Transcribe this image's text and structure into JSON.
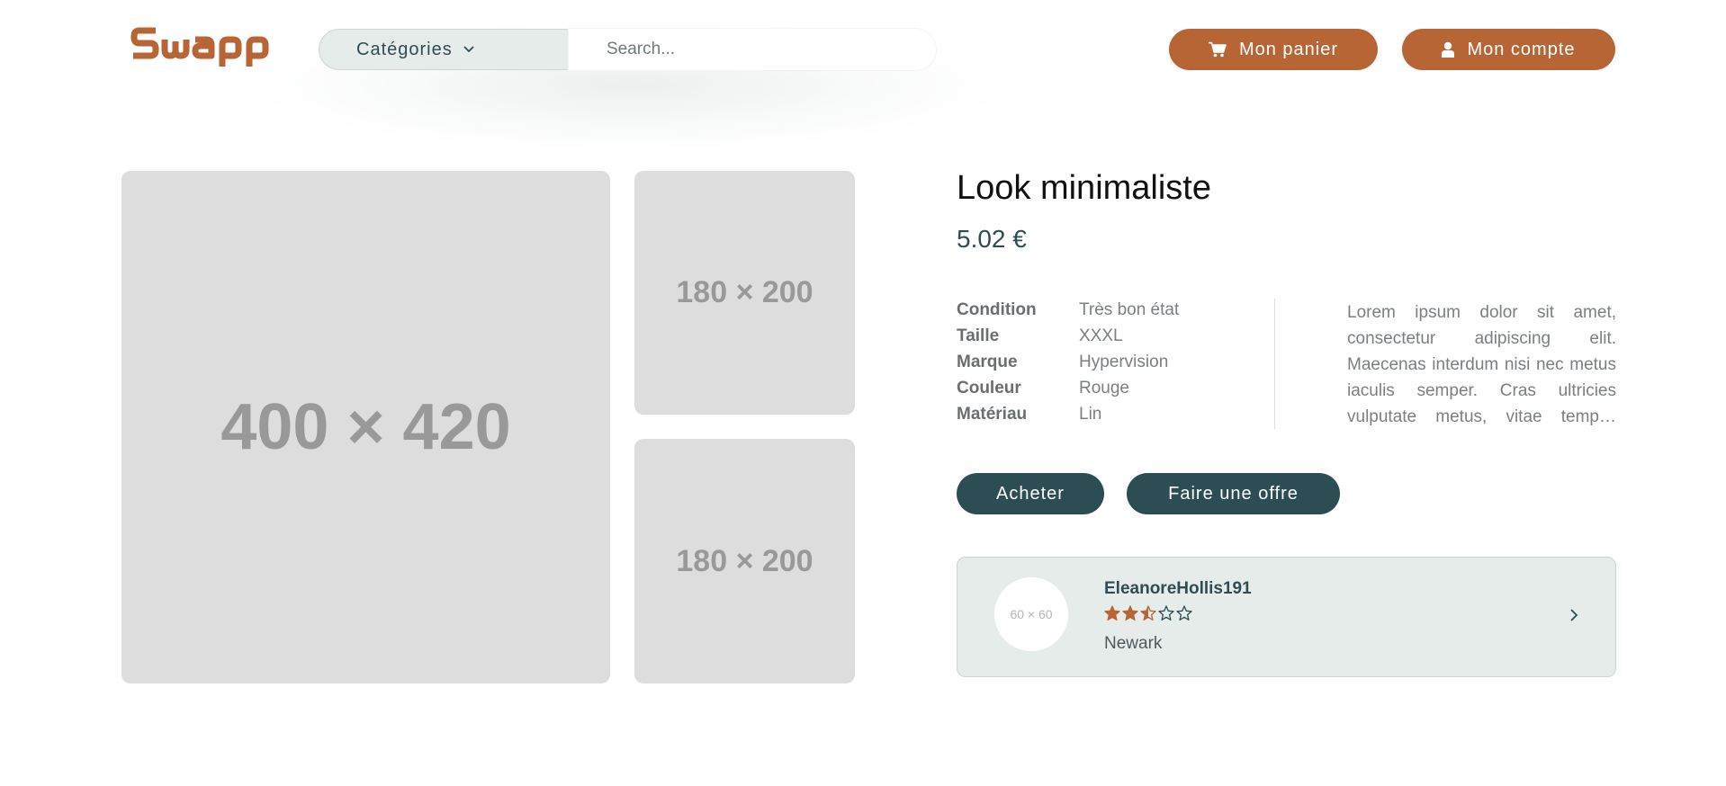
{
  "header": {
    "logo_text": "Swapp",
    "categories_label": "Catégories",
    "search_placeholder": "Search...",
    "cart_label": "Mon panier",
    "account_label": "Mon compte"
  },
  "gallery": {
    "main_label": "400 × 420",
    "side_labels": [
      "180 × 200",
      "180 × 200"
    ]
  },
  "product": {
    "title": "Look minimaliste",
    "price": "5.02 €",
    "specs": [
      {
        "key": "Condition",
        "value": "Très bon état"
      },
      {
        "key": "Taille",
        "value": "XXXL"
      },
      {
        "key": "Marque",
        "value": "Hypervision"
      },
      {
        "key": "Couleur",
        "value": "Rouge"
      },
      {
        "key": "Matériau",
        "value": "Lin"
      }
    ],
    "description": "Lorem ipsum dolor sit amet, consectetur adipiscing elit. Maecenas interdum nisi nec metus iaculis semper. Cras ultricies vulputate metus, vitae temp…",
    "buy_label": "Acheter",
    "offer_label": "Faire une offre"
  },
  "seller": {
    "avatar_label": "60 × 60",
    "name": "EleanoreHollis191",
    "rating": 2.5,
    "rating_max": 5,
    "city": "Newark"
  },
  "colors": {
    "brand": "#b86536",
    "dark": "#2d4d55",
    "light_panel": "#e6ecea",
    "placeholder": "#dddddd"
  },
  "icons": {
    "cart": "cart-icon",
    "account": "user-icon",
    "categories": "chevron-down-icon",
    "seller_card": "chevron-right-icon",
    "rating": "star-icon"
  }
}
